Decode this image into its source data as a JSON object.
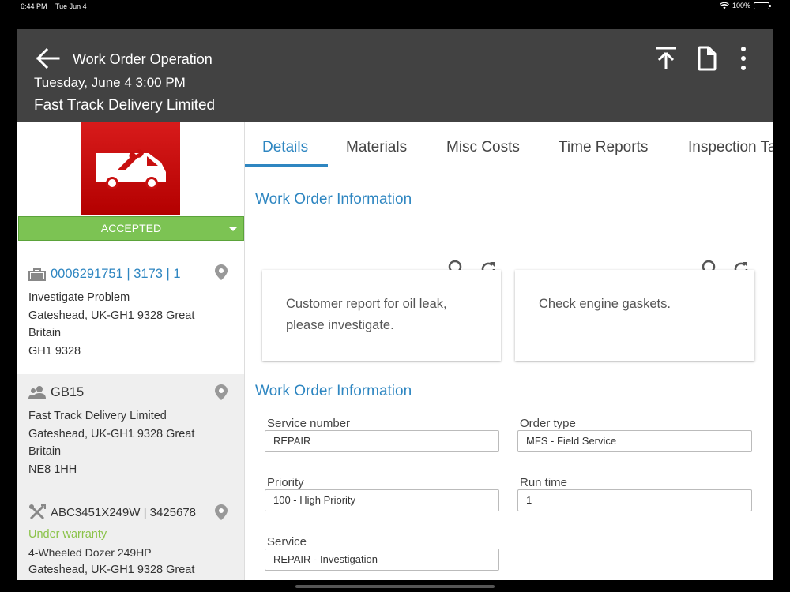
{
  "status_bar": {
    "time": "6:44 PM",
    "date": "Tue Jun 4",
    "battery": "100%"
  },
  "header": {
    "title": "Work Order Operation",
    "datetime": "Tuesday, June 4 3:00 PM",
    "company": "Fast Track Delivery Limited"
  },
  "left": {
    "status": "ACCEPTED",
    "order_card": {
      "id": "0006291751 | 3173 | 1",
      "lines": [
        "Investigate Problem",
        "Gateshead, UK-GH1 9328 Great",
        "Britain",
        "GH1 9328"
      ]
    },
    "customer_card": {
      "id": "GB15",
      "lines": [
        "Fast Track Delivery Limited",
        "Gateshead, UK-GH1 9328 Great",
        "Britain",
        "NE8 1HH"
      ]
    },
    "equipment_card": {
      "id": "ABC3451X249W | 3425678",
      "warranty": "Under warranty",
      "lines": [
        "4-Wheeled Dozer 249HP",
        "Gateshead, UK-GH1 9328 Great"
      ]
    }
  },
  "tabs": [
    "Details",
    "Materials",
    "Misc Costs",
    "Time Reports",
    "Inspection Ta"
  ],
  "section1": {
    "title": "Work Order Information",
    "note1": "Customer report for oil leak, please investigate.",
    "note2": "Check engine gaskets."
  },
  "section2": {
    "title": "Work Order Information",
    "fields": {
      "service_number": {
        "label": "Service number",
        "value": "REPAIR"
      },
      "order_type": {
        "label": "Order type",
        "value": "MFS - Field Service"
      },
      "priority": {
        "label": "Priority",
        "value": "100 - High Priority"
      },
      "run_time": {
        "label": "Run time",
        "value": "1"
      },
      "service": {
        "label": "Service",
        "value": "REPAIR - Investigation"
      }
    }
  },
  "colors": {
    "header_bg": "#424242",
    "accent": "#2e86c1",
    "status_green": "#7cc353",
    "logo_red": "#c80f0f",
    "warranty": "#8bc34a"
  }
}
